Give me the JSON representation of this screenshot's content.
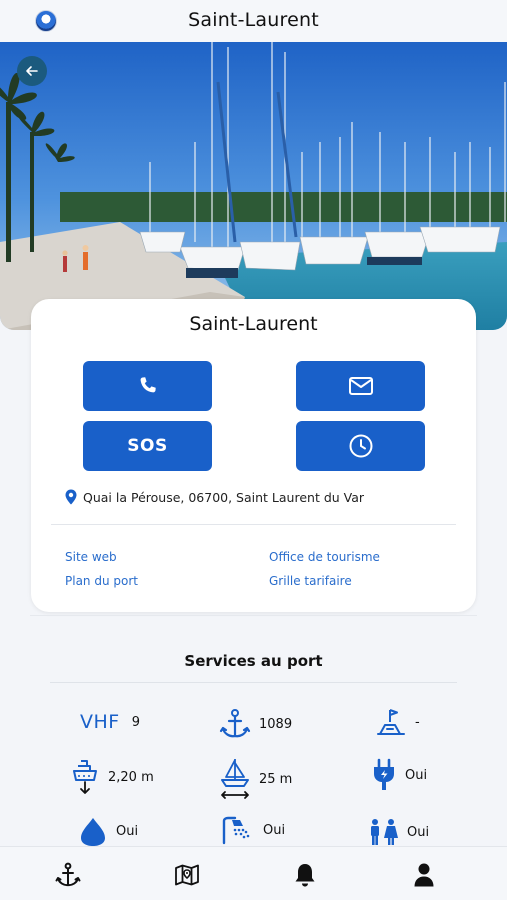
{
  "header": {
    "title": "Saint-Laurent",
    "logo_icon": "port-logo-icon"
  },
  "hero": {
    "back_icon": "arrow-left-icon"
  },
  "card": {
    "title": "Saint-Laurent",
    "buttons": {
      "phone_icon": "phone-icon",
      "email_icon": "envelope-icon",
      "sos_label": "SOS",
      "hours_icon": "clock-icon"
    },
    "address": "Quai la Pérouse, 06700, Saint Laurent du Var",
    "links": {
      "website": "Site web",
      "tourism": "Office de tourisme",
      "port_map": "Plan du port",
      "rates": "Grille tarifaire"
    }
  },
  "services": {
    "title": "Services au port",
    "vhf_label": "VHF",
    "vhf": "9",
    "moorings": "1089",
    "capitainerie": "-",
    "draft": "2,20 m",
    "length": "25 m",
    "electricity": "Oui",
    "fuel": "Oui",
    "showers": "Oui",
    "toilets": "Oui"
  },
  "tabs": [
    "anchor-icon",
    "map-icon",
    "bell-icon",
    "user-icon"
  ],
  "colors": {
    "primary": "#1960c9",
    "link": "#2a6dcc",
    "background": "#f3f5f9"
  }
}
